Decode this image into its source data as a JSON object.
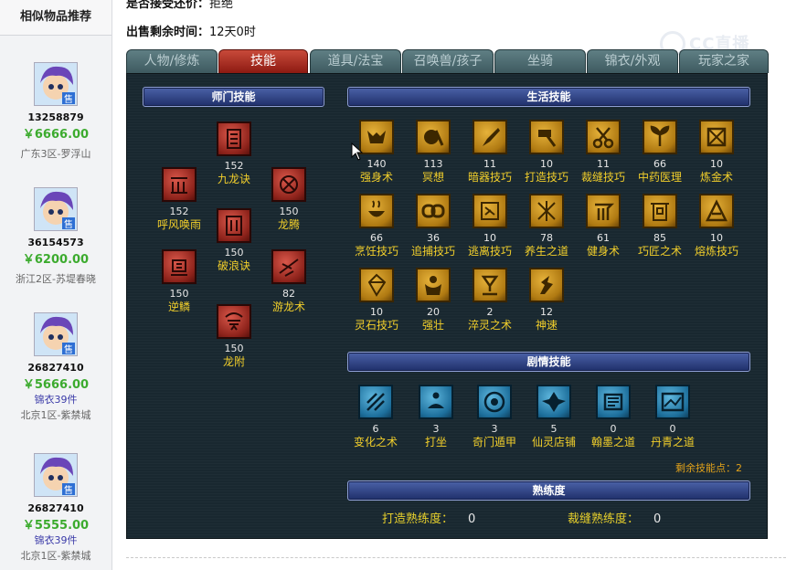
{
  "sidebar": {
    "title": "相似物品推荐",
    "items": [
      {
        "id": "13258879",
        "price": "￥6666.00",
        "sub": "",
        "server": "广东3区-罗浮山"
      },
      {
        "id": "36154573",
        "price": "￥6200.00",
        "sub": "",
        "server": "浙江2区-苏堤春晓"
      },
      {
        "id": "26827410",
        "price": "￥5666.00",
        "sub": "锦衣39件",
        "server": "北京1区-紫禁城"
      },
      {
        "id": "26827410",
        "price": "￥5555.00",
        "sub": "锦衣39件",
        "server": "北京1区-紫禁城"
      }
    ],
    "badge": "售"
  },
  "info": {
    "accept_label": "是否接受还价：",
    "accept_value": "拒绝",
    "time_label": "出售剩余时间：",
    "time_value": "12天0时"
  },
  "watermark": "CC直播",
  "tabs": [
    "人物/修炼",
    "技能",
    "道具/法宝",
    "召唤兽/孩子",
    "坐骑",
    "锦衣/外观",
    "玩家之家"
  ],
  "active_tab": "技能",
  "sections": {
    "school": "师门技能",
    "life": "生活技能",
    "story": "剧情技能",
    "proficiency": "熟练度"
  },
  "school_skills": [
    {
      "name": "九龙诀",
      "level": "152"
    },
    {
      "name": "呼风唤雨",
      "level": "152"
    },
    {
      "name": "龙腾",
      "level": "150"
    },
    {
      "name": "破浪诀",
      "level": "150"
    },
    {
      "name": "逆鳞",
      "level": "150"
    },
    {
      "name": "游龙术",
      "level": "82"
    },
    {
      "name": "龙附",
      "level": "150"
    }
  ],
  "life_skills": [
    {
      "name": "强身术",
      "level": "140"
    },
    {
      "name": "冥想",
      "level": "113"
    },
    {
      "name": "暗器技巧",
      "level": "11"
    },
    {
      "name": "打造技巧",
      "level": "10"
    },
    {
      "name": "裁缝技巧",
      "level": "11"
    },
    {
      "name": "中药医理",
      "level": "66"
    },
    {
      "name": "炼金术",
      "level": "10"
    },
    {
      "name": "烹饪技巧",
      "level": "66"
    },
    {
      "name": "追捕技巧",
      "level": "36"
    },
    {
      "name": "逃离技巧",
      "level": "10"
    },
    {
      "name": "养生之道",
      "level": "78"
    },
    {
      "name": "健身术",
      "level": "61"
    },
    {
      "name": "巧匠之术",
      "level": "85"
    },
    {
      "name": "熔炼技巧",
      "level": "10"
    },
    {
      "name": "灵石技巧",
      "level": "10"
    },
    {
      "name": "强壮",
      "level": "20"
    },
    {
      "name": "淬灵之术",
      "level": "2"
    },
    {
      "name": "神速",
      "level": "12"
    }
  ],
  "story_skills": [
    {
      "name": "变化之术",
      "level": "6"
    },
    {
      "name": "打坐",
      "level": "3"
    },
    {
      "name": "奇门遁甲",
      "level": "3"
    },
    {
      "name": "仙灵店铺",
      "level": "5"
    },
    {
      "name": "翰墨之道",
      "level": "0"
    },
    {
      "name": "丹青之道",
      "level": "0"
    }
  ],
  "remaining_points": "剩余技能点：2",
  "proficiency": [
    {
      "label": "打造熟练度：",
      "value": "0"
    },
    {
      "label": "裁缝熟练度：",
      "value": "0"
    }
  ]
}
